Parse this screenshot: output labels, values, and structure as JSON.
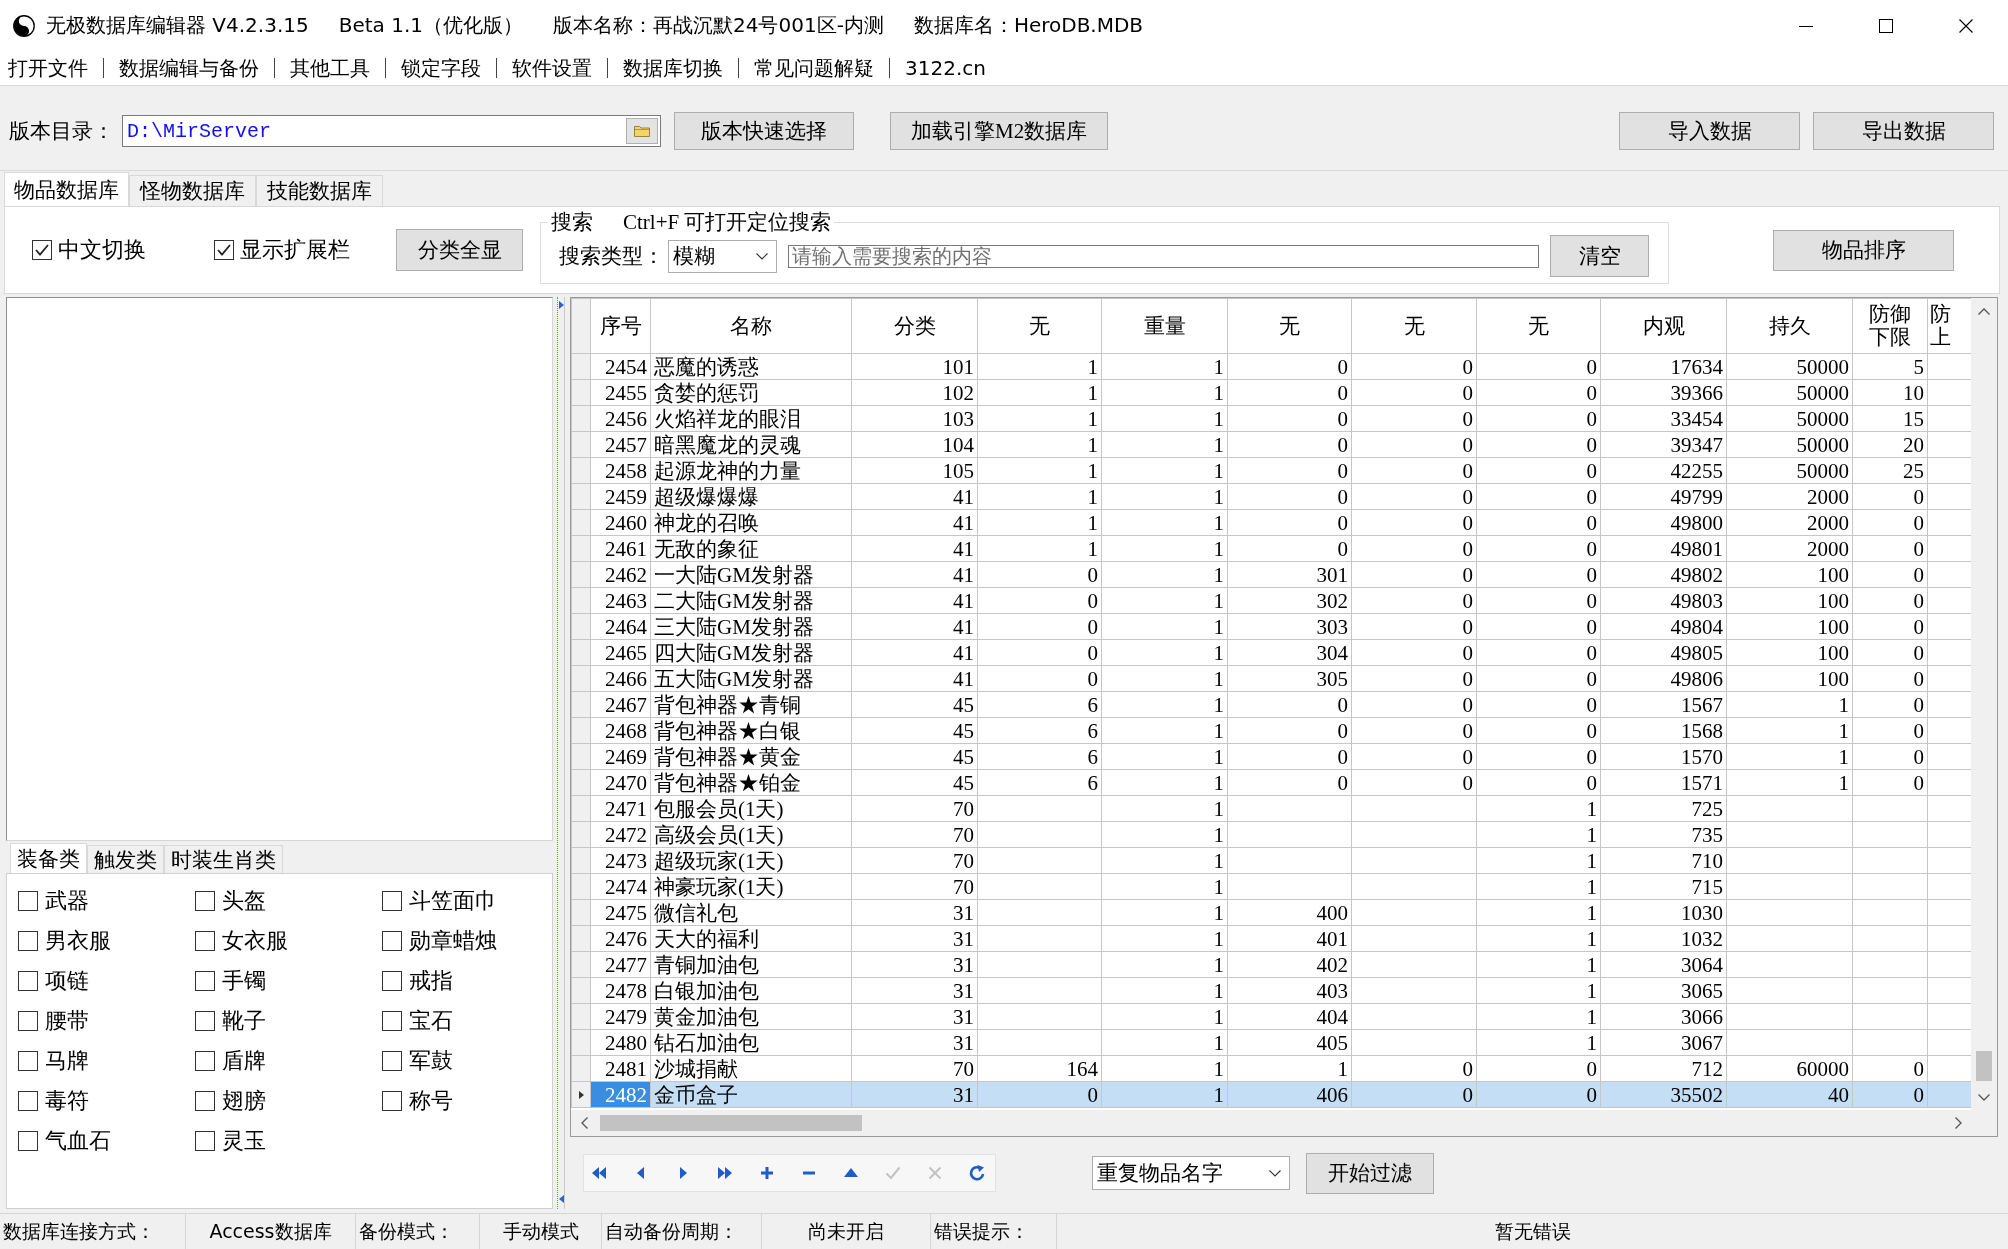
{
  "window": {
    "title_parts": [
      "无极数据库编辑器 V4.2.3.15",
      "Beta 1.1（优化版）",
      "版本名称：再战沉默24号001区-内测",
      "数据库名：HeroDB.MDB"
    ]
  },
  "menu": [
    "打开文件",
    "数据编辑与备份",
    "其他工具",
    "锁定字段",
    "软件设置",
    "数据库切换",
    "常见问题解疑",
    "3122.cn"
  ],
  "directory": {
    "label": "版本目录：",
    "value": "D:\\MirServer"
  },
  "left_buttons": [
    "版本快速选择",
    "加载引擎M2数据库"
  ],
  "right_buttons": [
    "导入数据",
    "导出数据"
  ],
  "tabs": [
    {
      "label": "物品数据库",
      "selected": true
    },
    {
      "label": "怪物数据库",
      "selected": false
    },
    {
      "label": "技能数据库",
      "selected": false
    }
  ],
  "options": [
    {
      "label": "中文切换",
      "checked": true
    },
    {
      "label": "显示扩展栏",
      "checked": true
    }
  ],
  "show_all_button": "分类全显",
  "search": {
    "title": "搜索",
    "hint": "Ctrl+F 可打开定位搜索",
    "type_label": "搜索类型：",
    "type_value": "模糊",
    "placeholder": "请输入需要搜索的内容",
    "clear_button": "清空"
  },
  "sort_button": "物品排序",
  "category_tabs": [
    {
      "label": "装备类",
      "selected": true
    },
    {
      "label": "触发类",
      "selected": false
    },
    {
      "label": "时装生肖类",
      "selected": false
    }
  ],
  "categories": [
    {
      "label": "武器",
      "checked": false
    },
    {
      "label": "头盔",
      "checked": false
    },
    {
      "label": "斗笠面巾",
      "checked": false
    },
    {
      "label": "男衣服",
      "checked": false
    },
    {
      "label": "女衣服",
      "checked": false
    },
    {
      "label": "勋章蜡烛",
      "checked": false
    },
    {
      "label": "项链",
      "checked": false
    },
    {
      "label": "手镯",
      "checked": false
    },
    {
      "label": "戒指",
      "checked": false
    },
    {
      "label": "腰带",
      "checked": false
    },
    {
      "label": "靴子",
      "checked": false
    },
    {
      "label": "宝石",
      "checked": false
    },
    {
      "label": "马牌",
      "checked": false
    },
    {
      "label": "盾牌",
      "checked": false
    },
    {
      "label": "军鼓",
      "checked": false
    },
    {
      "label": "毒符",
      "checked": false
    },
    {
      "label": "翅膀",
      "checked": false
    },
    {
      "label": "称号",
      "checked": false
    },
    {
      "label": "气血石",
      "checked": false
    },
    {
      "label": "灵玉",
      "checked": false
    }
  ],
  "table": {
    "columns": [
      "序号",
      "名称",
      "分类",
      "无",
      "重量",
      "无",
      "无",
      "无",
      "内观",
      "持久",
      "防御下限",
      "防上"
    ],
    "rows": [
      {
        "cells": [
          "2454",
          "恶魔的诱惑",
          "101",
          "1",
          "1",
          "0",
          "0",
          "0",
          "17634",
          "50000",
          "5"
        ],
        "selected": false
      },
      {
        "cells": [
          "2455",
          "贪婪的惩罚",
          "102",
          "1",
          "1",
          "0",
          "0",
          "0",
          "39366",
          "50000",
          "10"
        ],
        "selected": false
      },
      {
        "cells": [
          "2456",
          "火焰祥龙的眼泪",
          "103",
          "1",
          "1",
          "0",
          "0",
          "0",
          "33454",
          "50000",
          "15"
        ],
        "selected": false
      },
      {
        "cells": [
          "2457",
          "暗黑魔龙的灵魂",
          "104",
          "1",
          "1",
          "0",
          "0",
          "0",
          "39347",
          "50000",
          "20"
        ],
        "selected": false
      },
      {
        "cells": [
          "2458",
          "起源龙神的力量",
          "105",
          "1",
          "1",
          "0",
          "0",
          "0",
          "42255",
          "50000",
          "25"
        ],
        "selected": false
      },
      {
        "cells": [
          "2459",
          "超级爆爆爆",
          "41",
          "1",
          "1",
          "0",
          "0",
          "0",
          "49799",
          "2000",
          "0"
        ],
        "selected": false
      },
      {
        "cells": [
          "2460",
          "神龙的召唤",
          "41",
          "1",
          "1",
          "0",
          "0",
          "0",
          "49800",
          "2000",
          "0"
        ],
        "selected": false
      },
      {
        "cells": [
          "2461",
          "无敌的象征",
          "41",
          "1",
          "1",
          "0",
          "0",
          "0",
          "49801",
          "2000",
          "0"
        ],
        "selected": false
      },
      {
        "cells": [
          "2462",
          "一大陆GM发射器",
          "41",
          "0",
          "1",
          "301",
          "0",
          "0",
          "49802",
          "100",
          "0"
        ],
        "selected": false
      },
      {
        "cells": [
          "2463",
          "二大陆GM发射器",
          "41",
          "0",
          "1",
          "302",
          "0",
          "0",
          "49803",
          "100",
          "0"
        ],
        "selected": false
      },
      {
        "cells": [
          "2464",
          "三大陆GM发射器",
          "41",
          "0",
          "1",
          "303",
          "0",
          "0",
          "49804",
          "100",
          "0"
        ],
        "selected": false
      },
      {
        "cells": [
          "2465",
          "四大陆GM发射器",
          "41",
          "0",
          "1",
          "304",
          "0",
          "0",
          "49805",
          "100",
          "0"
        ],
        "selected": false
      },
      {
        "cells": [
          "2466",
          "五大陆GM发射器",
          "41",
          "0",
          "1",
          "305",
          "0",
          "0",
          "49806",
          "100",
          "0"
        ],
        "selected": false
      },
      {
        "cells": [
          "2467",
          "背包神器★青铜",
          "45",
          "6",
          "1",
          "0",
          "0",
          "0",
          "1567",
          "1",
          "0"
        ],
        "selected": false
      },
      {
        "cells": [
          "2468",
          "背包神器★白银",
          "45",
          "6",
          "1",
          "0",
          "0",
          "0",
          "1568",
          "1",
          "0"
        ],
        "selected": false
      },
      {
        "cells": [
          "2469",
          "背包神器★黄金",
          "45",
          "6",
          "1",
          "0",
          "0",
          "0",
          "1570",
          "1",
          "0"
        ],
        "selected": false
      },
      {
        "cells": [
          "2470",
          "背包神器★铂金",
          "45",
          "6",
          "1",
          "0",
          "0",
          "0",
          "1571",
          "1",
          "0"
        ],
        "selected": false
      },
      {
        "cells": [
          "2471",
          "包服会员(1天)",
          "70",
          null,
          "1",
          null,
          null,
          "1",
          "725",
          null,
          null
        ],
        "selected": false
      },
      {
        "cells": [
          "2472",
          "高级会员(1天)",
          "70",
          null,
          "1",
          null,
          null,
          "1",
          "735",
          null,
          null
        ],
        "selected": false
      },
      {
        "cells": [
          "2473",
          "超级玩家(1天)",
          "70",
          null,
          "1",
          null,
          null,
          "1",
          "710",
          null,
          null
        ],
        "selected": false
      },
      {
        "cells": [
          "2474",
          "神豪玩家(1天)",
          "70",
          null,
          "1",
          null,
          null,
          "1",
          "715",
          null,
          null
        ],
        "selected": false
      },
      {
        "cells": [
          "2475",
          "微信礼包",
          "31",
          null,
          "1",
          "400",
          null,
          "1",
          "1030",
          null,
          null
        ],
        "selected": false
      },
      {
        "cells": [
          "2476",
          "天大的福利",
          "31",
          null,
          "1",
          "401",
          null,
          "1",
          "1032",
          null,
          null
        ],
        "selected": false
      },
      {
        "cells": [
          "2477",
          "青铜加油包",
          "31",
          null,
          "1",
          "402",
          null,
          "1",
          "3064",
          null,
          null
        ],
        "selected": false
      },
      {
        "cells": [
          "2478",
          "白银加油包",
          "31",
          null,
          "1",
          "403",
          null,
          "1",
          "3065",
          null,
          null
        ],
        "selected": false
      },
      {
        "cells": [
          "2479",
          "黄金加油包",
          "31",
          null,
          "1",
          "404",
          null,
          "1",
          "3066",
          null,
          null
        ],
        "selected": false
      },
      {
        "cells": [
          "2480",
          "钻石加油包",
          "31",
          null,
          "1",
          "405",
          null,
          "1",
          "3067",
          null,
          null
        ],
        "selected": false
      },
      {
        "cells": [
          "2481",
          "沙城捐献",
          "70",
          "164",
          "1",
          "1",
          "0",
          "0",
          "712",
          "60000",
          "0"
        ],
        "selected": false
      },
      {
        "cells": [
          "2482",
          "金币盒子",
          "31",
          "0",
          "1",
          "406",
          "0",
          "0",
          "35502",
          "40",
          "0"
        ],
        "selected": true
      }
    ]
  },
  "navigator": [
    {
      "kind": "first",
      "disabled": false
    },
    {
      "kind": "prior",
      "disabled": false
    },
    {
      "kind": "next",
      "disabled": false
    },
    {
      "kind": "last",
      "disabled": false
    },
    {
      "kind": "insert",
      "disabled": false
    },
    {
      "kind": "delete",
      "disabled": false
    },
    {
      "kind": "edit",
      "disabled": false
    },
    {
      "kind": "post",
      "disabled": true
    },
    {
      "kind": "cancel",
      "disabled": true
    },
    {
      "kind": "refresh",
      "disabled": false
    }
  ],
  "filter": {
    "value": "重复物品名字",
    "button": "开始过滤"
  },
  "status_bar": [
    {
      "label": "数据库连接方式：",
      "value": "Access数据库"
    },
    {
      "label": "备份模式：",
      "value": "手动模式"
    },
    {
      "label": "自动备份周期：",
      "value": "尚未开启"
    },
    {
      "label": "错误提示：",
      "value": "暂无错误"
    }
  ]
}
